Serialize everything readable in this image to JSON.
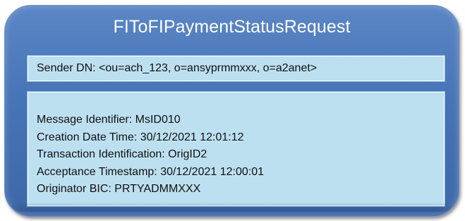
{
  "title": "FIToFIPaymentStatusRequest",
  "sender": {
    "text": "Sender DN: <ou=ach_123, o=ansyprmmxxx, o=a2anet>"
  },
  "details": {
    "lines": [
      "Message Identifier: MsID010",
      "Creation Date Time: 30/12/2021 12:01:12",
      "Transaction Identification: OrigID2",
      "Acceptance Timestamp: 30/12/2021 12:00:01",
      "Originator BIC: PRTYADMMXXX"
    ]
  },
  "colors": {
    "card": "#4674b6",
    "panel": "#bde0f1",
    "title_text": "#ffffff"
  }
}
